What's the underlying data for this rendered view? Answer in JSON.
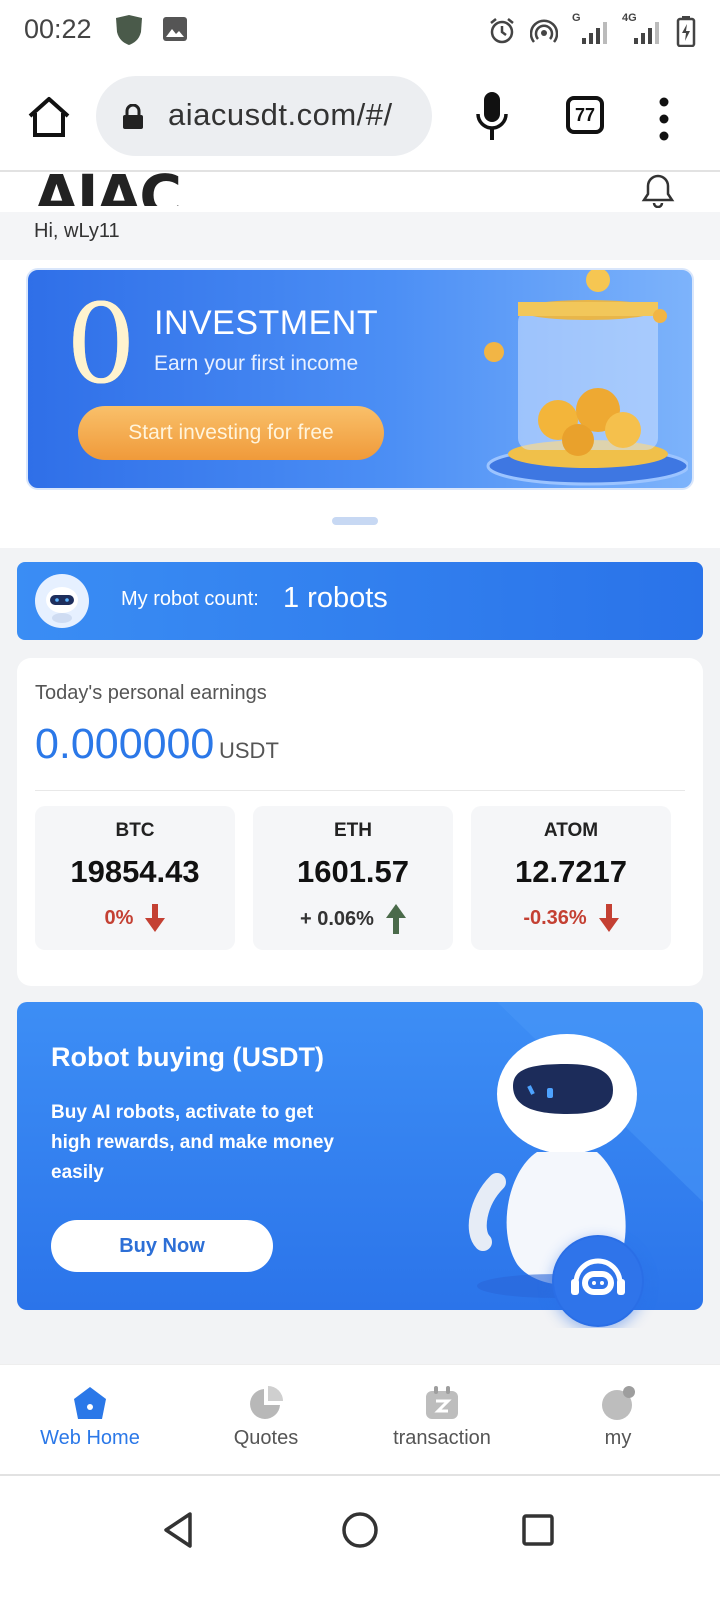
{
  "status_bar": {
    "time": "00:22",
    "network_labels": [
      "G",
      "4G"
    ]
  },
  "browser": {
    "url": "aiacusdt.com/#/",
    "tab_count": "77"
  },
  "header": {
    "greeting": "Hi, wLy11"
  },
  "banner": {
    "big_number": "0",
    "title": "INVESTMENT",
    "subtitle": "Earn your first income",
    "button_label": "Start investing for free"
  },
  "robot_count": {
    "label": "My robot count:",
    "value": "1 robots"
  },
  "earnings": {
    "title": "Today's personal earnings",
    "amount": "0.000000",
    "unit": "USDT"
  },
  "coins": [
    {
      "symbol": "BTC",
      "price": "19854.43",
      "change": "0%",
      "direction": "down"
    },
    {
      "symbol": "ETH",
      "price": "1601.57",
      "change": "+ 0.06%",
      "direction": "up"
    },
    {
      "symbol": "ATOM",
      "price": "12.7217",
      "change": "-0.36%",
      "direction": "down"
    }
  ],
  "buy_card": {
    "title": "Robot buying (USDT)",
    "description": "Buy AI robots, activate to get high rewards, and make money easily",
    "button_label": "Buy Now"
  },
  "bottom_nav": [
    {
      "label": "Web Home",
      "icon": "home-icon",
      "active": true
    },
    {
      "label": "Quotes",
      "icon": "pie-chart-icon",
      "active": false
    },
    {
      "label": "transaction",
      "icon": "transaction-icon",
      "active": false
    },
    {
      "label": "my",
      "icon": "user-icon",
      "active": false
    }
  ],
  "colors": {
    "accent": "#2b78e8",
    "down": "#c44033",
    "up": "#4a6a4a"
  }
}
